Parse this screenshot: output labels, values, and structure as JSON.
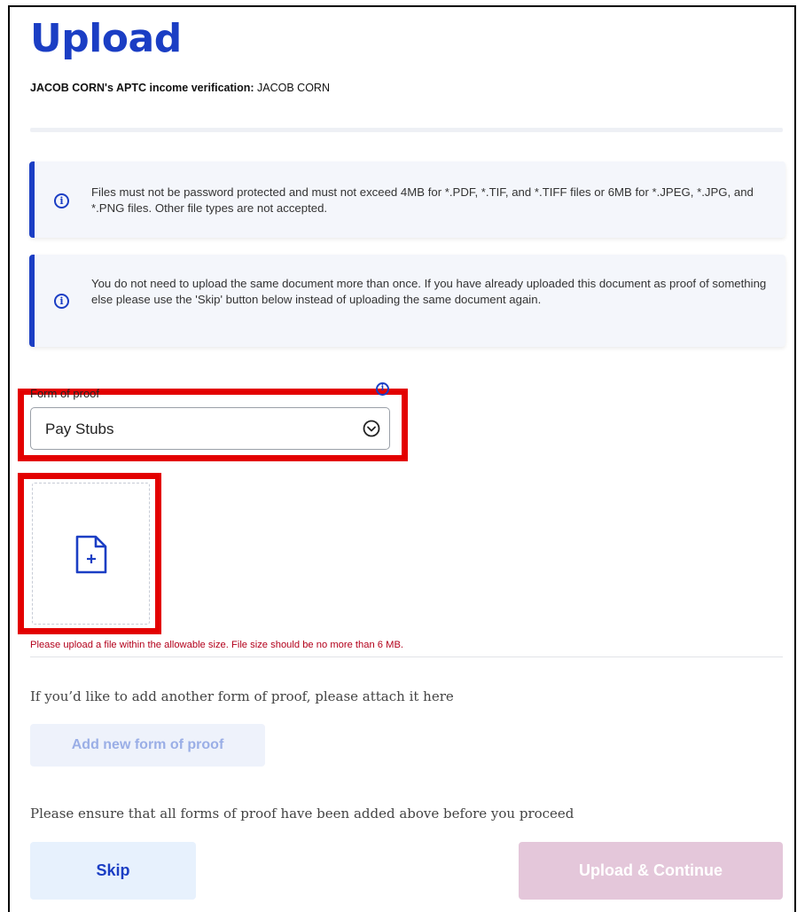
{
  "page": {
    "title": "Upload",
    "subtitle_bold": "JACOB CORN's APTC income verification:",
    "subtitle_rest": " JACOB CORN"
  },
  "alerts": [
    {
      "icon": "info-icon",
      "text": "Files must not be password protected and must not exceed 4MB for *.PDF, *.TIF, and *.TIFF files or 6MB for *.JPEG, *.JPG, and *.PNG files. Other file types are not accepted."
    },
    {
      "icon": "info-icon",
      "text": "You do not need to upload the same document more than once. If you have already uploaded this document as proof of something else please use the 'Skip' button below instead of uploading the same document again."
    }
  ],
  "form": {
    "label": "Form of proof",
    "selected_value": "Pay Stubs",
    "error": "Please upload a file within the allowable size. File size should be no more than 6 MB."
  },
  "add_section": {
    "prompt": "If you’d like to add another form of proof, please attach it here",
    "button_label": "Add new form of proof"
  },
  "footer": {
    "prompt": "Please ensure that all forms of proof have been added above before you proceed",
    "skip_label": "Skip",
    "continue_label": "Upload & Continue"
  },
  "colors": {
    "brand": "#1b3ec4",
    "highlight": "#e30000",
    "error": "#b3001b",
    "disabled_continue": "#e4c7da"
  }
}
